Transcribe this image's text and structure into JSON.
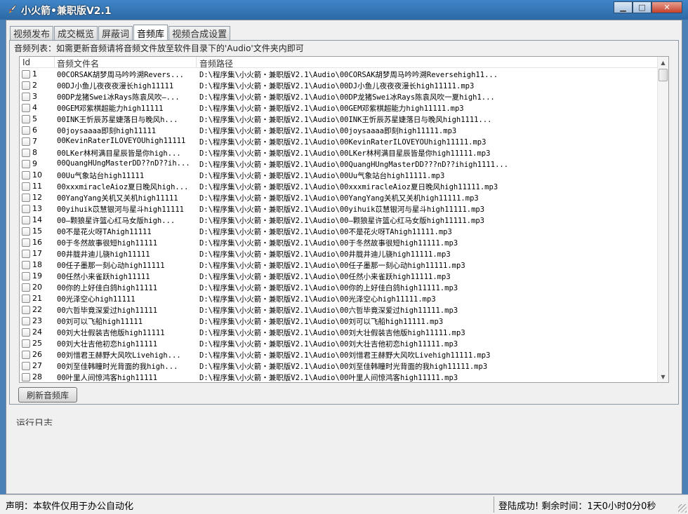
{
  "window": {
    "title": "小火箭•兼职版V2.1",
    "icon": "rocket-icon",
    "controls": {
      "minimize": "▁",
      "maximize": "□",
      "close": "✕"
    }
  },
  "tabs": [
    {
      "label": "视频发布",
      "active": false
    },
    {
      "label": "成交概览",
      "active": false
    },
    {
      "label": "屏蔽词",
      "active": false
    },
    {
      "label": "音频库",
      "active": true
    },
    {
      "label": "视频合成设置",
      "active": false
    }
  ],
  "audio": {
    "hint": "音频列表：如需更新音频请将音频文件放至软件目录下的'Audio'文件夹内即可",
    "columns": {
      "id": "Id",
      "name": "音频文件名",
      "path": "音频路径"
    },
    "rows": [
      {
        "id": "1",
        "name": "00CORSAK胡梦周马吟吟溯Revers...",
        "path": "D:\\程序集\\小火箭・兼职版V2.1\\Audio\\00CORSAK胡梦周马吟吟溯Reversehigh11..."
      },
      {
        "id": "2",
        "name": "00DJ小鱼儿夜夜夜漫长high11111",
        "path": "D:\\程序集\\小火箭・兼职版V2.1\\Audio\\00DJ小鱼儿夜夜夜漫长high11111.mp3"
      },
      {
        "id": "3",
        "name": "00DP龙猪Swei冰Rays陈袁风吹—...",
        "path": "D:\\程序集\\小火箭・兼职版V2.1\\Audio\\00DP龙猪Swei冰Rays陈袁风吹一夏high1..."
      },
      {
        "id": "4",
        "name": "00GEM邓紫棋超能力high11111",
        "path": "D:\\程序集\\小火箭・兼职版V2.1\\Audio\\00GEM邓紫棋超能力high11111.mp3"
      },
      {
        "id": "5",
        "name": "00INK王忻辰苏星婕落日与晚风h...",
        "path": "D:\\程序集\\小火箭・兼职版V2.1\\Audio\\00INK王忻辰苏星婕落日与晚风high1111..."
      },
      {
        "id": "6",
        "name": "00joysaaaa即刻high11111",
        "path": "D:\\程序集\\小火箭・兼职版V2.1\\Audio\\00joysaaaa即刻high11111.mp3"
      },
      {
        "id": "7",
        "name": "00KevinRaterILOVEYOUhigh11111",
        "path": "D:\\程序集\\小火箭・兼职版V2.1\\Audio\\00KevinRaterILOVEYOUhigh11111.mp3"
      },
      {
        "id": "8",
        "name": "00LKer林柯满目星辰皆是你high...",
        "path": "D:\\程序集\\小火箭・兼职版V2.1\\Audio\\00LKer林柯满目星辰皆是你high11111.mp3"
      },
      {
        "id": "9",
        "name": "00QuangHUngMasterDD??nD??ih...",
        "path": "D:\\程序集\\小火箭・兼职版V2.1\\Audio\\00QuangHUngMasterDD???nD??ihigh1111..."
      },
      {
        "id": "10",
        "name": "00Uu气象站台high11111",
        "path": "D:\\程序集\\小火箭・兼职版V2.1\\Audio\\00Uu气象站台high11111.mp3"
      },
      {
        "id": "11",
        "name": "00xxxmiracleAioz夏日晚风high...",
        "path": "D:\\程序集\\小火箭・兼职版V2.1\\Audio\\00xxxmiracleAioz夏日晚风high11111.mp3"
      },
      {
        "id": "12",
        "name": "00YangYang关机又关机high11111",
        "path": "D:\\程序集\\小火箭・兼职版V2.1\\Audio\\00YangYang关机又关机high11111.mp3"
      },
      {
        "id": "13",
        "name": "00yihuik苡慧银河与星斗high11111",
        "path": "D:\\程序集\\小火箭・兼职版V2.1\\Audio\\00yihuik苡慧银河与星斗high11111.mp3"
      },
      {
        "id": "14",
        "name": "00—颗狼星许篮心红马女版high...",
        "path": "D:\\程序集\\小火箭・兼职版V2.1\\Audio\\00—颗狼星许篮心红马女版high11111.mp3"
      },
      {
        "id": "15",
        "name": "00不是花火呀TAhigh11111",
        "path": "D:\\程序集\\小火箭・兼职版V2.1\\Audio\\00不是花火呀TAhigh11111.mp3"
      },
      {
        "id": "16",
        "name": "00于冬然故事很短high11111",
        "path": "D:\\程序集\\小火箭・兼职版V2.1\\Audio\\00于冬然故事很短high11111.mp3"
      },
      {
        "id": "17",
        "name": "00井胧井迪儿骁high11111",
        "path": "D:\\程序集\\小火箭・兼职版V2.1\\Audio\\00井胧井迪儿骁high11111.mp3"
      },
      {
        "id": "18",
        "name": "00任子墨那一刻心动high11111",
        "path": "D:\\程序集\\小火箭・兼职版V2.1\\Audio\\00任子墨那一刻心动high11111.mp3"
      },
      {
        "id": "19",
        "name": "00任然小来雀跃high11111",
        "path": "D:\\程序集\\小火箭・兼职版V2.1\\Audio\\00任然小来雀跃high11111.mp3"
      },
      {
        "id": "20",
        "name": "00你的上好佳白鸽high11111",
        "path": "D:\\程序集\\小火箭・兼职版V2.1\\Audio\\00你的上好佳白鸽high11111.mp3"
      },
      {
        "id": "21",
        "name": "00光泽空心high11111",
        "path": "D:\\程序集\\小火箭・兼职版V2.1\\Audio\\00光泽空心high11111.mp3"
      },
      {
        "id": "22",
        "name": "00六哲毕竟深爱过high11111",
        "path": "D:\\程序集\\小火箭・兼职版V2.1\\Audio\\00六哲毕竟深爱过high11111.mp3"
      },
      {
        "id": "23",
        "name": "00刘可以飞船high11111",
        "path": "D:\\程序集\\小火箭・兼职版V2.1\\Audio\\00刘可以飞船high11111.mp3"
      },
      {
        "id": "24",
        "name": "00刘大壮假装吉他版high11111",
        "path": "D:\\程序集\\小火箭・兼职版V2.1\\Audio\\00刘大壮假装吉他版high11111.mp3"
      },
      {
        "id": "25",
        "name": "00刘大壮吉他初恋high11111",
        "path": "D:\\程序集\\小火箭・兼职版V2.1\\Audio\\00刘大壮吉他初恋high11111.mp3"
      },
      {
        "id": "26",
        "name": "00刘惜君王赫野大风吹Livehigh...",
        "path": "D:\\程序集\\小火箭・兼职版V2.1\\Audio\\00刘惜君王赫野大风吹Livehigh11111.mp3"
      },
      {
        "id": "27",
        "name": "00刘至佳韩瞳时光背面的我high...",
        "path": "D:\\程序集\\小火箭・兼职版V2.1\\Audio\\00刘至佳韩瞳时光背面的我high11111.mp3"
      },
      {
        "id": "28",
        "name": "00叶里人间惊鸿客high11111",
        "path": "D:\\程序集\\小火箭・兼职版V2.1\\Audio\\00叶里人间惊鸿客high11111.mp3"
      }
    ],
    "refresh_label": "刷新音频库"
  },
  "log": {
    "label": "运行日志"
  },
  "status": {
    "left": "声明：本软件仅用于办公自动化",
    "right": "登陆成功! 剩余时间：1天0小时0分0秒"
  }
}
